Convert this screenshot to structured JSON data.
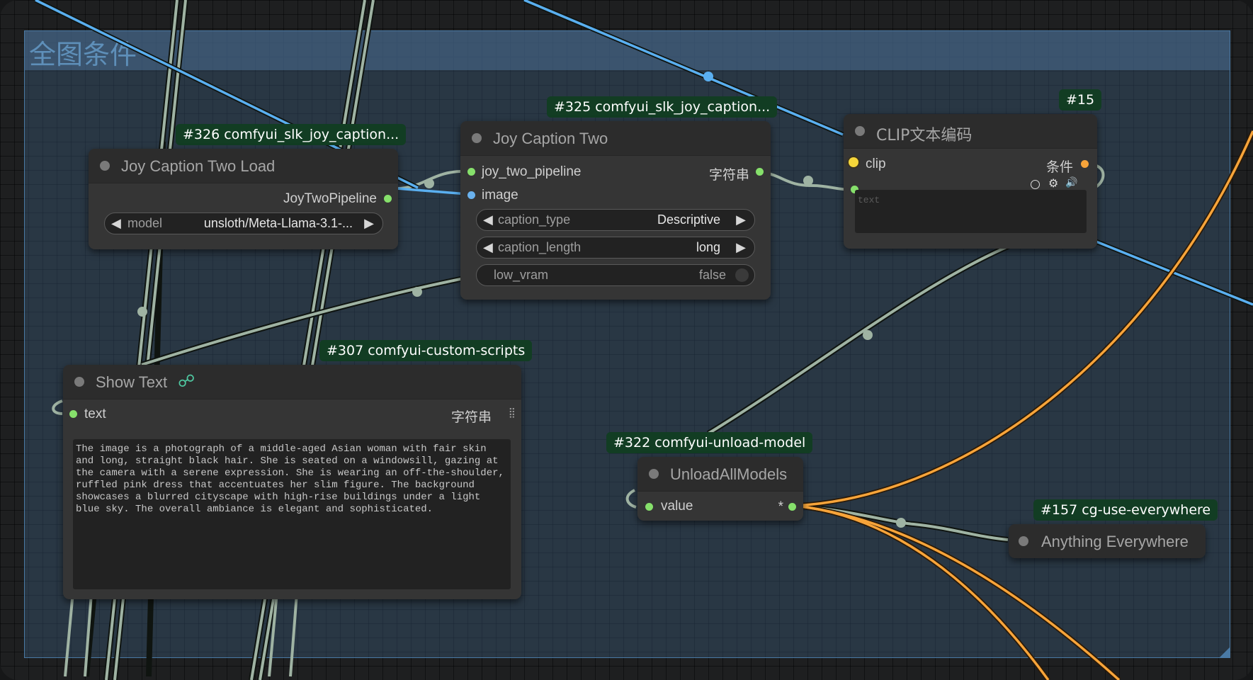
{
  "group": {
    "title": "全图条件"
  },
  "colors": {
    "link_gray": "#9fb3a3",
    "link_blue": "#5aaff0",
    "link_orange": "#f7a43a",
    "badge_bg": "#123d23"
  },
  "nodes": {
    "joy_load": {
      "badge": "#326 comfyui_slk_joy_caption...",
      "title": "Joy Caption Two Load",
      "output_label": "JoyTwoPipeline",
      "model_label": "model",
      "model_value": "unsloth/Meta-Llama-3.1-..."
    },
    "joy_two": {
      "badge": "#325 comfyui_slk_joy_caption...",
      "title": "Joy Caption Two",
      "input_pipeline": "joy_two_pipeline",
      "input_image": "image",
      "output_label": "字符串",
      "caption_type_label": "caption_type",
      "caption_type_value": "Descriptive",
      "caption_length_label": "caption_length",
      "caption_length_value": "long",
      "low_vram_label": "low_vram",
      "low_vram_value": "false"
    },
    "clip": {
      "badge": "#15",
      "title": "CLIP文本编码",
      "input_clip": "clip",
      "output_label": "条件",
      "text_placeholder": "text"
    },
    "show_text": {
      "badge": "#307 comfyui-custom-scripts",
      "title": "Show Text",
      "input_text": "text",
      "output_label": "字符串",
      "content": "The image is a photograph of a middle-aged Asian woman with fair skin and long, straight black hair. She is seated on a windowsill, gazing at the camera with a serene expression. She is wearing an off-the-shoulder, ruffled pink dress that accentuates her slim figure. The background showcases a blurred cityscape with high-rise buildings under a light blue sky. The overall ambiance is elegant and sophisticated."
    },
    "unload": {
      "badge": "#322 comfyui-unload-model",
      "title": "UnloadAllModels",
      "input_value": "value",
      "output_label": "*"
    },
    "anything": {
      "badge": "#157 cg-use-everywhere",
      "title": "Anything Everywhere"
    }
  }
}
